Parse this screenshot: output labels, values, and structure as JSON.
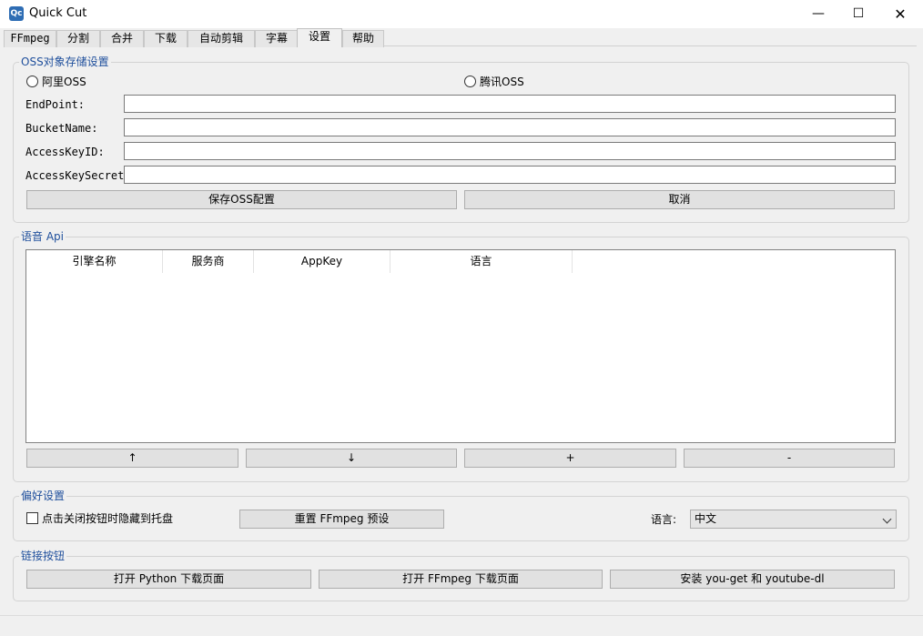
{
  "window": {
    "title": "Quick Cut",
    "icon_text": "Qc",
    "minimize": "—",
    "maximize": "☐",
    "close": "✕"
  },
  "tabs": [
    {
      "label": "FFmpeg"
    },
    {
      "label": "分割"
    },
    {
      "label": "合并"
    },
    {
      "label": "下载"
    },
    {
      "label": "自动剪辑"
    },
    {
      "label": "字幕"
    },
    {
      "label": "设置"
    },
    {
      "label": "帮助"
    }
  ],
  "oss": {
    "title": "OSS对象存储设置",
    "aliyun_label": "阿里OSS",
    "tencent_label": "腾讯OSS",
    "endpoint_label": "EndPoint:",
    "bucket_label": "BucketName:",
    "keyid_label": "AccessKeyID:",
    "secret_label": "AccessKeySecret:",
    "endpoint_value": "",
    "bucket_value": "",
    "keyid_value": "",
    "secret_value": "",
    "save_label": "保存OSS配置",
    "cancel_label": "取消"
  },
  "speech": {
    "title": "语音 Api",
    "columns": [
      "引擎名称",
      "服务商",
      "AppKey",
      "语言"
    ],
    "up_label": "↑",
    "down_label": "↓",
    "add_label": "+",
    "remove_label": "-"
  },
  "prefs": {
    "title": "偏好设置",
    "tray_label": "点击关闭按钮时隐藏到托盘",
    "reset_label": "重置 FFmpeg 预设",
    "lang_label": "语言:",
    "lang_value": "中文"
  },
  "links": {
    "title": "链接按钮",
    "python_label": "打开 Python 下载页面",
    "ffmpeg_label": "打开 FFmpeg 下载页面",
    "install_label": "安装 you-get 和 youtube-dl"
  }
}
